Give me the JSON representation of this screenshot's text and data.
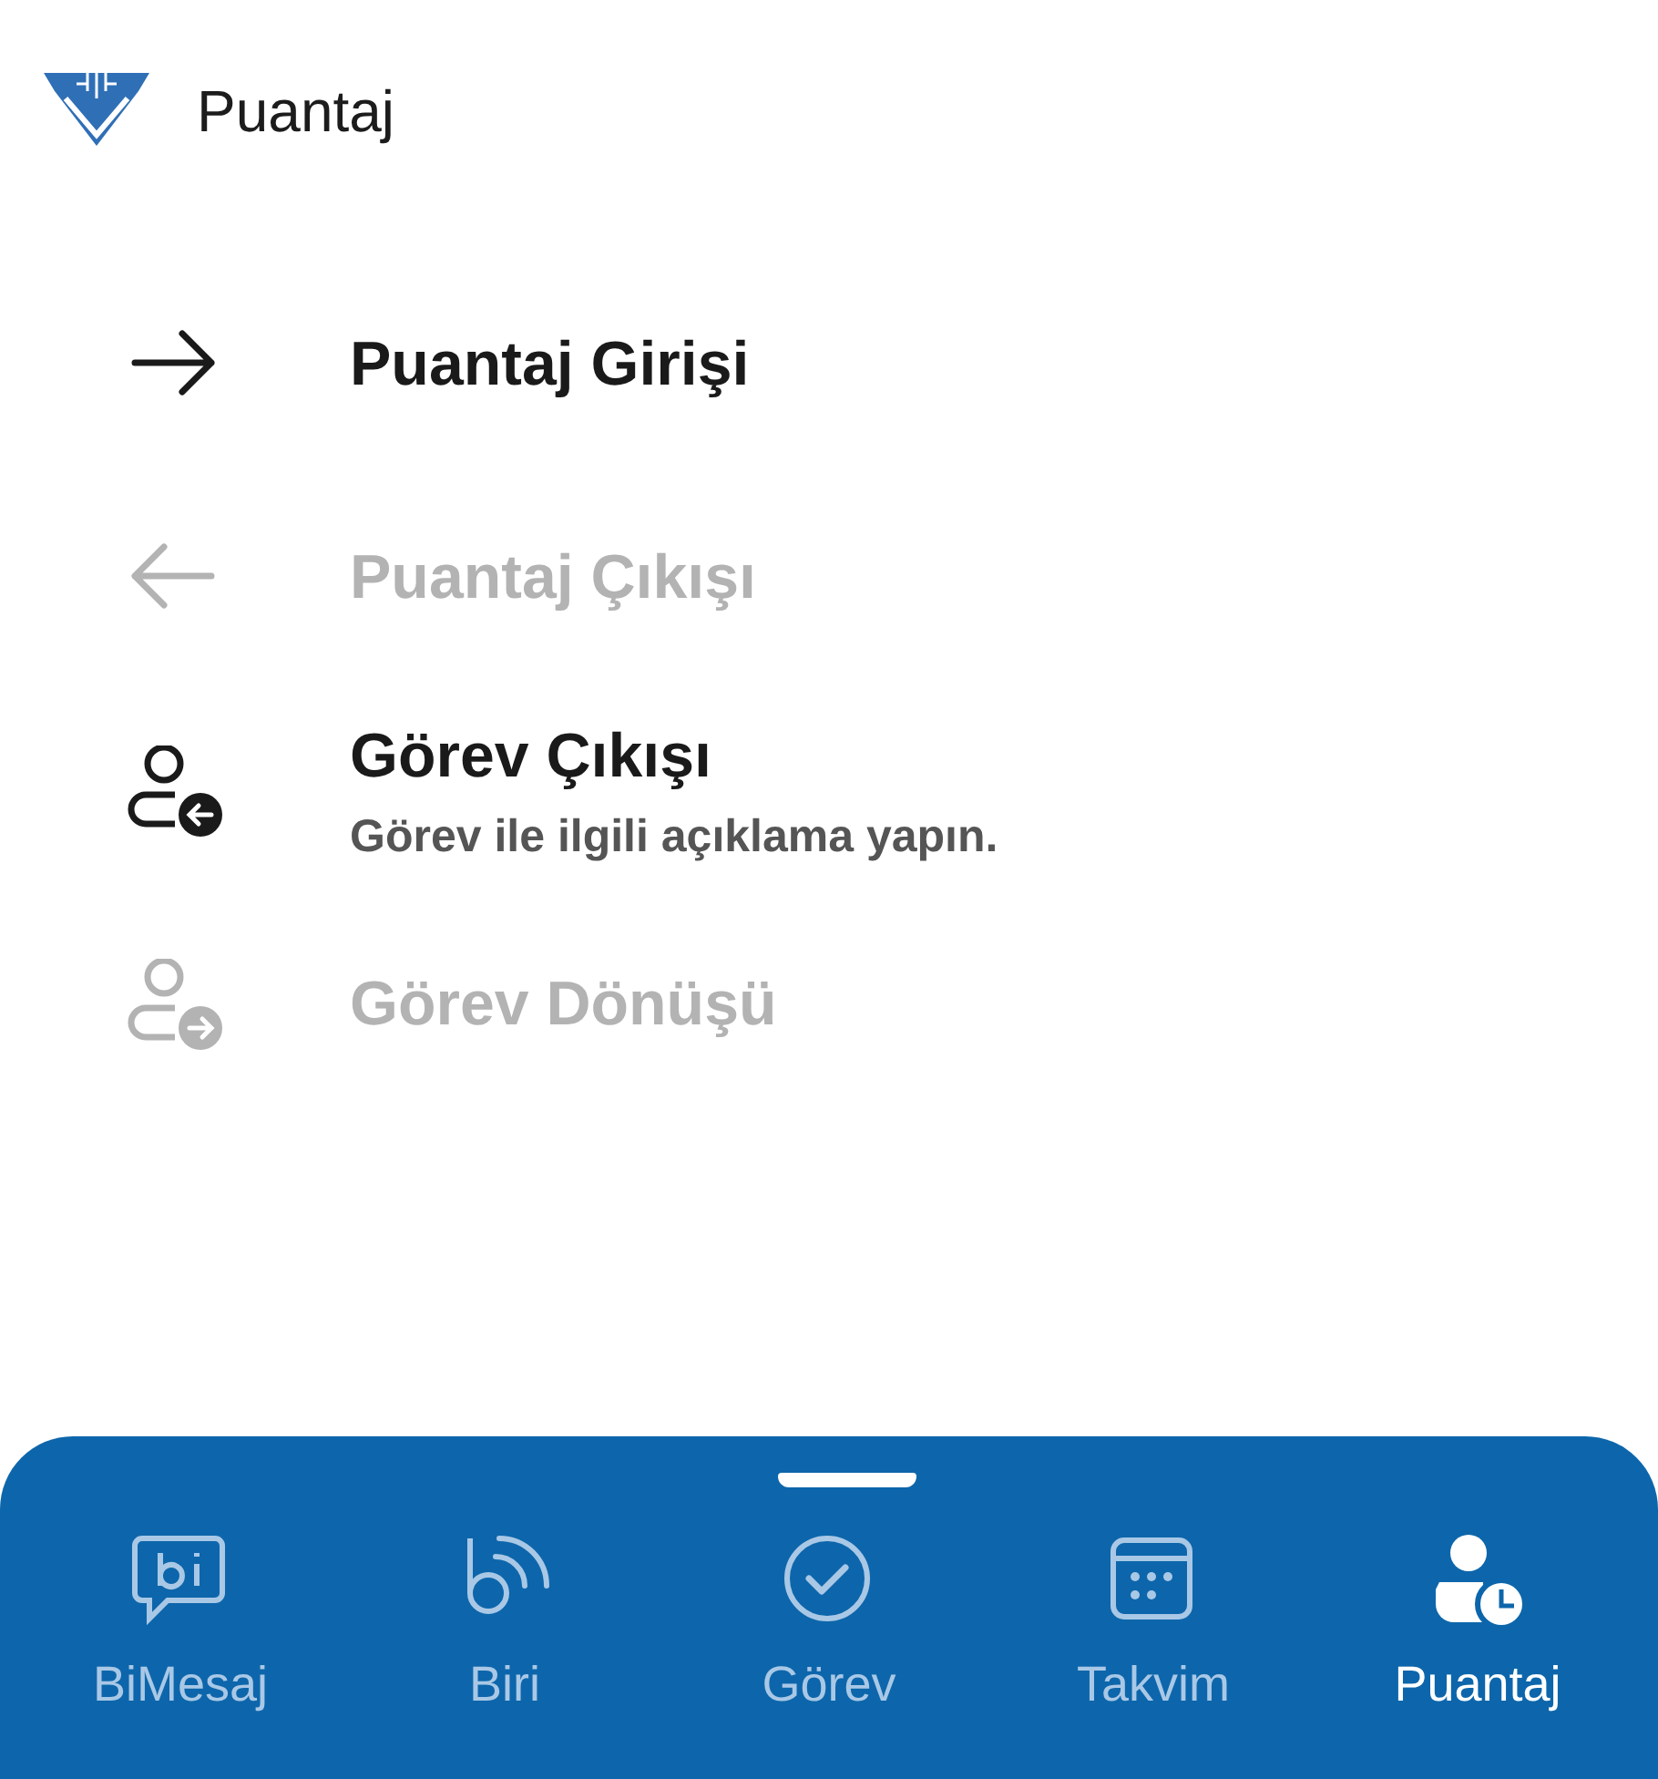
{
  "header": {
    "title": "Puantaj"
  },
  "menu": [
    {
      "kind": "arrow-right",
      "label": "Puantaj Girişi",
      "disabled": false
    },
    {
      "kind": "arrow-left",
      "label": "Puantaj Çıkışı",
      "disabled": true
    },
    {
      "kind": "person-out",
      "label": "Görev Çıkışı",
      "subtitle": "Görev ile ilgili açıklama yapın.",
      "disabled": false
    },
    {
      "kind": "person-in",
      "label": "Görev Dönüşü",
      "disabled": true
    }
  ],
  "tabs": [
    {
      "kind": "message",
      "label": "BiMesaj",
      "selected": false
    },
    {
      "kind": "signal",
      "label": "Biri",
      "selected": false
    },
    {
      "kind": "task",
      "label": "Görev",
      "selected": false
    },
    {
      "kind": "calendar",
      "label": "Takvim",
      "selected": false
    },
    {
      "kind": "timesheet",
      "label": "Puantaj",
      "selected": true
    }
  ]
}
